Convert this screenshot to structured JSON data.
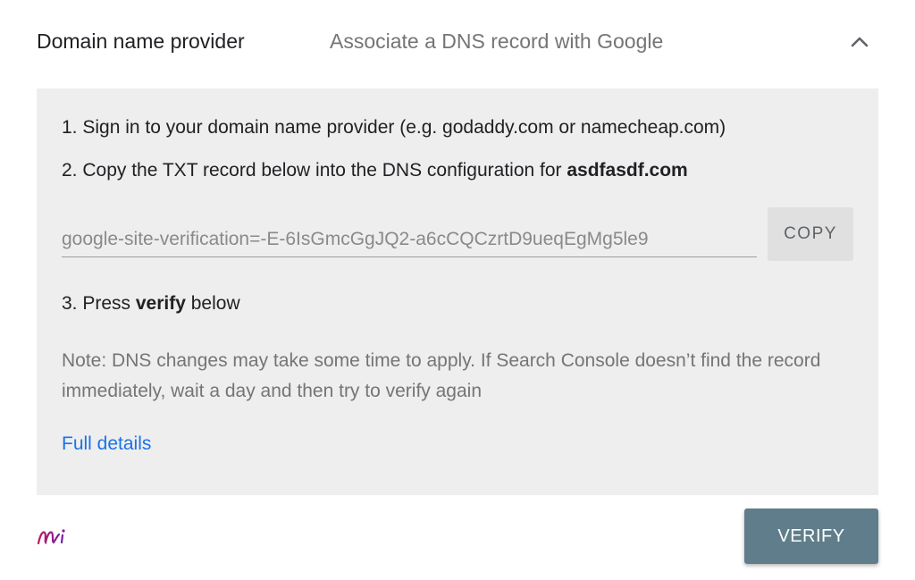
{
  "header": {
    "title": "Domain name provider",
    "subtitle": "Associate a DNS record with Google",
    "chevron_icon": "chevron-up-icon"
  },
  "steps": {
    "step1": "1. Sign in to your domain name provider (e.g. godaddy.com or namecheap.com)",
    "step2_prefix": "2. Copy the TXT record below into the DNS configuration for ",
    "step2_domain": "asdfasdf.com",
    "step3_prefix": "3. Press ",
    "step3_bold": "verify",
    "step3_suffix": " below"
  },
  "txt_record": {
    "value": "google-site-verification=-E-6IsGmcGgJQ2-a6cCQCzrtD9ueqEgMg5le9",
    "copy_label": "COPY"
  },
  "note": "Note: DNS changes may take some time to apply. If Search Console doesn’t find the record immediately, wait a day and then try to verify again",
  "details_link": "Full details",
  "footer": {
    "logo_icon": "app-logo-icon",
    "verify_label": "VERIFY"
  },
  "colors": {
    "panel_bg": "#eeeeee",
    "link": "#1a73e8",
    "verify_bg": "#607d8b",
    "copy_bg": "#e0e0e0"
  }
}
